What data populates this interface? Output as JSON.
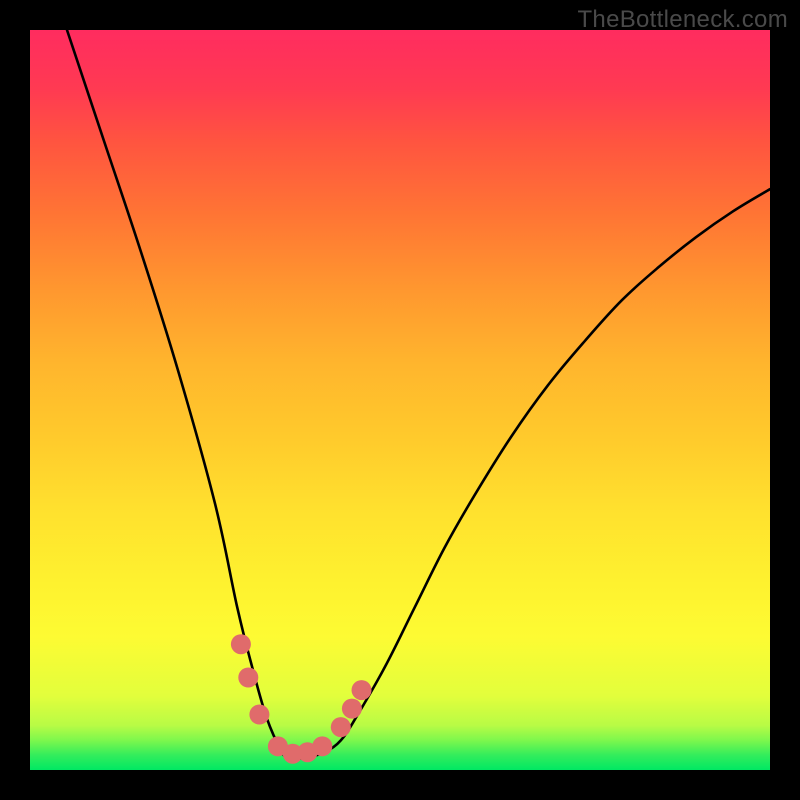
{
  "watermark": "TheBottleneck.com",
  "chart_data": {
    "type": "line",
    "title": "",
    "xlabel": "",
    "ylabel": "",
    "xlim": [
      0,
      100
    ],
    "ylim": [
      0,
      100
    ],
    "series": [
      {
        "name": "curve",
        "x": [
          5,
          10,
          15,
          20,
          25,
          28,
          30,
          32,
          34,
          35,
          36,
          38,
          40,
          42,
          44,
          48,
          52,
          56,
          60,
          65,
          70,
          75,
          80,
          85,
          90,
          95,
          100
        ],
        "values": [
          100,
          85,
          70,
          54,
          36,
          22,
          14,
          7,
          2.5,
          1.5,
          1.5,
          1.8,
          2.5,
          4,
          7,
          14,
          22,
          30,
          37,
          45,
          52,
          58,
          63.5,
          68,
          72,
          75.5,
          78.5
        ]
      }
    ],
    "markers": [
      {
        "x": 28.5,
        "y": 17
      },
      {
        "x": 29.5,
        "y": 12.5
      },
      {
        "x": 31,
        "y": 7.5
      },
      {
        "x": 33.5,
        "y": 3.2
      },
      {
        "x": 35.5,
        "y": 2.2
      },
      {
        "x": 37.5,
        "y": 2.4
      },
      {
        "x": 39.5,
        "y": 3.2
      },
      {
        "x": 42,
        "y": 5.8
      },
      {
        "x": 43.5,
        "y": 8.3
      },
      {
        "x": 44.8,
        "y": 10.8
      }
    ],
    "marker_color": "#e06b6b",
    "gradient_stops": [
      {
        "pos": 0,
        "color": "#00e863"
      },
      {
        "pos": 10,
        "color": "#e2fe3c"
      },
      {
        "pos": 25,
        "color": "#fef22f"
      },
      {
        "pos": 55,
        "color": "#ffb52d"
      },
      {
        "pos": 85,
        "color": "#ff5440"
      },
      {
        "pos": 100,
        "color": "#ff2c5f"
      }
    ]
  }
}
